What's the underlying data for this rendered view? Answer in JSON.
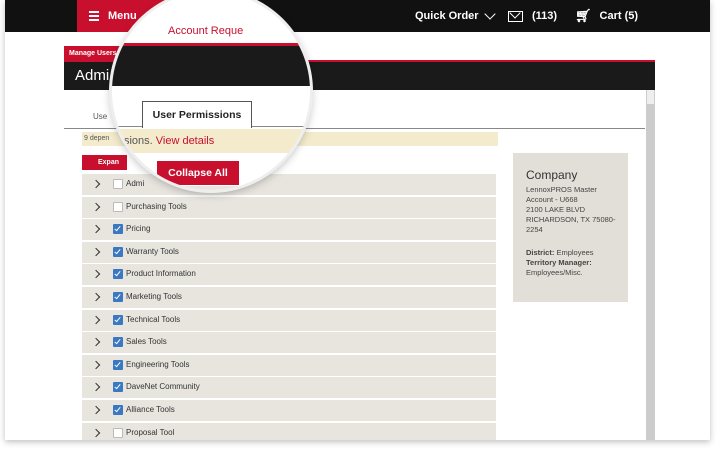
{
  "topbar": {
    "menu_label": "Menu",
    "quick_order_label": "Quick Order",
    "messages_count": "(113)",
    "cart_label": "Cart (5)"
  },
  "tabs": {
    "manage_users": "Manage Users",
    "account_requests": "Account Reque",
    "users_tab": "Use",
    "user_permissions": "User Permissions"
  },
  "page_title": "Admi",
  "notice": {
    "prefix": "9 depen",
    "text": "issions.",
    "link": "View details"
  },
  "buttons": {
    "expand_all": "Expan",
    "collapse_all": "Collapse All"
  },
  "permissions": [
    {
      "label": "Admi",
      "checked": false
    },
    {
      "label": "Purchasing Tools",
      "checked": false
    },
    {
      "label": "Pricing",
      "checked": true
    },
    {
      "label": "Warranty Tools",
      "checked": true
    },
    {
      "label": "Product Information",
      "checked": true
    },
    {
      "label": "Marketing Tools",
      "checked": true
    },
    {
      "label": "Technical Tools",
      "checked": true
    },
    {
      "label": "Sales Tools",
      "checked": true
    },
    {
      "label": "Engineering Tools",
      "checked": true
    },
    {
      "label": "DaveNet Community",
      "checked": true
    },
    {
      "label": "Alliance Tools",
      "checked": true
    },
    {
      "label": "Proposal Tool",
      "checked": false
    }
  ],
  "company": {
    "title": "Company",
    "line1": "LennoxPROS Master Account - U668",
    "line2": "2100 LAKE BLVD",
    "line3": "RICHARDSON, TX 75080-2254",
    "district_label": "District:",
    "district_value": "Employees",
    "tm_label": "Territory Manager:",
    "tm_value": "Employees/Misc."
  },
  "colors": {
    "brand_red": "#c8102e",
    "topbar": "#111111",
    "row_bg": "#e8e5df",
    "checkbox_blue": "#3a78c2"
  }
}
